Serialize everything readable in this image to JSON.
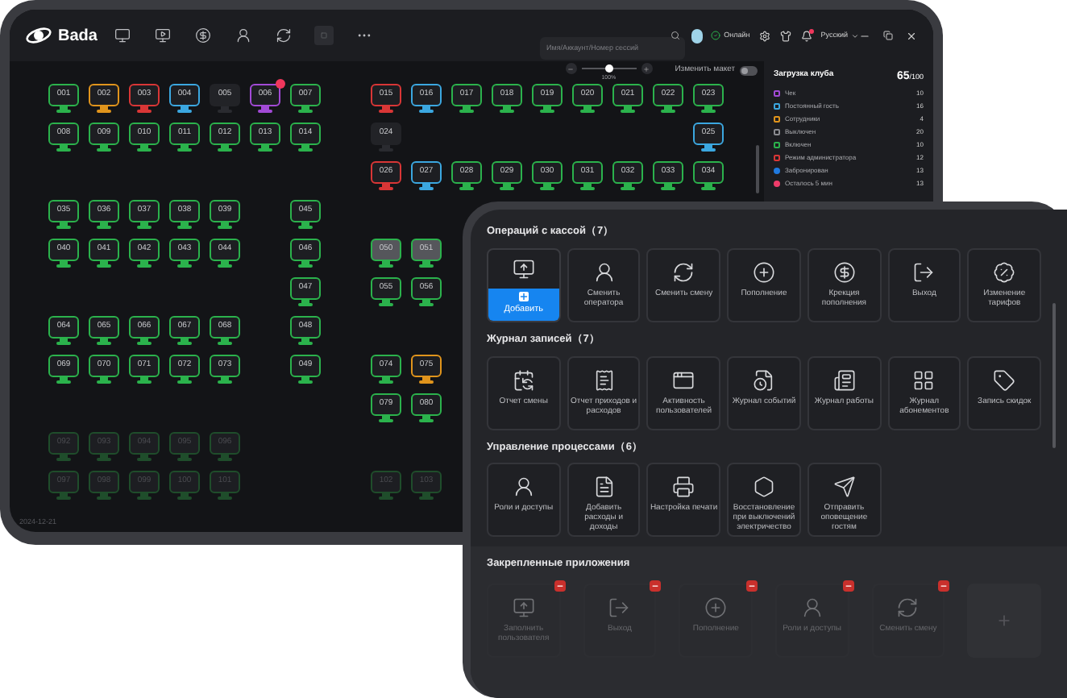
{
  "app": {
    "name": "Bada"
  },
  "search": {
    "placeholder": "Имя/Аккаунт/Номер сессий"
  },
  "status": {
    "label": "Онлайн"
  },
  "language": {
    "label": "Русский"
  },
  "notifications": {
    "unread": true
  },
  "zoom": {
    "level": 0.5,
    "reading": "100%"
  },
  "layout_toggle": {
    "label": "Изменить макет",
    "on": false
  },
  "seat_rows": [
    [
      {
        "label": "001",
        "color": "#2bb24c",
        "kind": "on",
        "alert": false
      },
      {
        "label": "002",
        "color": "#e0941c",
        "kind": "on",
        "alert": false
      },
      {
        "label": "003",
        "color": "#d93636",
        "kind": "on",
        "alert": false
      },
      {
        "label": "004",
        "color": "#3ba7e0",
        "kind": "on",
        "alert": false
      },
      {
        "label": "005",
        "color": "#2a2b30",
        "kind": "off",
        "alert": false
      },
      {
        "label": "006",
        "color": "#a24ad6",
        "kind": "on",
        "alert": true
      },
      {
        "label": "007",
        "color": "#2bb24c",
        "kind": "on",
        "alert": false
      },
      null,
      {
        "label": "015",
        "color": "#d93636",
        "kind": "on",
        "alert": false
      },
      {
        "label": "016",
        "color": "#3ba7e0",
        "kind": "on",
        "alert": false
      },
      {
        "label": "017",
        "color": "#2bb24c",
        "kind": "on",
        "alert": false
      },
      {
        "label": "018",
        "color": "#2bb24c",
        "kind": "on",
        "alert": false
      },
      {
        "label": "019",
        "color": "#2bb24c",
        "kind": "on",
        "alert": false
      },
      {
        "label": "020",
        "color": "#2bb24c",
        "kind": "on",
        "alert": false
      },
      {
        "label": "021",
        "color": "#2bb24c",
        "kind": "on",
        "alert": false
      },
      {
        "label": "022",
        "color": "#2bb24c",
        "kind": "on",
        "alert": false
      },
      {
        "label": "023",
        "color": "#2bb24c",
        "kind": "on",
        "alert": false
      }
    ],
    [
      {
        "label": "008",
        "color": "#2bb24c",
        "kind": "on",
        "alert": false
      },
      {
        "label": "009",
        "color": "#2bb24c",
        "kind": "on",
        "alert": false
      },
      {
        "label": "010",
        "color": "#2bb24c",
        "kind": "on",
        "alert": false
      },
      {
        "label": "011",
        "color": "#2bb24c",
        "kind": "on",
        "alert": false
      },
      {
        "label": "012",
        "color": "#2bb24c",
        "kind": "on",
        "alert": false
      },
      {
        "label": "013",
        "color": "#2bb24c",
        "kind": "on",
        "alert": false
      },
      {
        "label": "014",
        "color": "#2bb24c",
        "kind": "on",
        "alert": false
      },
      null,
      {
        "label": "024",
        "color": "#2a2b30",
        "kind": "off",
        "alert": false
      },
      null,
      null,
      null,
      null,
      null,
      null,
      null,
      {
        "label": "025",
        "color": "#3ba7e0",
        "kind": "on",
        "alert": false
      }
    ],
    [
      null,
      null,
      null,
      null,
      null,
      null,
      null,
      null,
      {
        "label": "026",
        "color": "#d93636",
        "kind": "on",
        "alert": false
      },
      {
        "label": "027",
        "color": "#3ba7e0",
        "kind": "on",
        "alert": false
      },
      {
        "label": "028",
        "color": "#2bb24c",
        "kind": "on",
        "alert": false
      },
      {
        "label": "029",
        "color": "#2bb24c",
        "kind": "on",
        "alert": false
      },
      {
        "label": "030",
        "color": "#2bb24c",
        "kind": "on",
        "alert": false
      },
      {
        "label": "031",
        "color": "#2bb24c",
        "kind": "on",
        "alert": false
      },
      {
        "label": "032",
        "color": "#2bb24c",
        "kind": "on",
        "alert": false
      },
      {
        "label": "033",
        "color": "#2bb24c",
        "kind": "on",
        "alert": false
      },
      {
        "label": "034",
        "color": "#2bb24c",
        "kind": "on",
        "alert": false
      }
    ],
    [
      {
        "label": "035",
        "color": "#2bb24c",
        "kind": "on",
        "alert": false
      },
      {
        "label": "036",
        "color": "#2bb24c",
        "kind": "on",
        "alert": false
      },
      {
        "label": "037",
        "color": "#2bb24c",
        "kind": "on",
        "alert": false
      },
      {
        "label": "038",
        "color": "#2bb24c",
        "kind": "on",
        "alert": false
      },
      {
        "label": "039",
        "color": "#2bb24c",
        "kind": "on",
        "alert": false
      },
      null,
      {
        "label": "045",
        "color": "#2bb24c",
        "kind": "on",
        "alert": false
      }
    ],
    [
      {
        "label": "040",
        "color": "#2bb24c",
        "kind": "on",
        "alert": false
      },
      {
        "label": "041",
        "color": "#2bb24c",
        "kind": "on",
        "alert": false
      },
      {
        "label": "042",
        "color": "#2bb24c",
        "kind": "on",
        "alert": false
      },
      {
        "label": "043",
        "color": "#2bb24c",
        "kind": "on",
        "alert": false
      },
      {
        "label": "044",
        "color": "#2bb24c",
        "kind": "on",
        "alert": false
      },
      null,
      {
        "label": "046",
        "color": "#2bb24c",
        "kind": "on",
        "alert": false
      },
      null,
      {
        "label": "050",
        "color": "#2bb24c",
        "kind": "busy",
        "alert": false
      },
      {
        "label": "051",
        "color": "#2bb24c",
        "kind": "busy",
        "alert": false
      }
    ],
    [
      null,
      null,
      null,
      null,
      null,
      null,
      {
        "label": "047",
        "color": "#2bb24c",
        "kind": "on",
        "alert": false
      },
      null,
      {
        "label": "055",
        "color": "#2bb24c",
        "kind": "on",
        "alert": false
      },
      {
        "label": "056",
        "color": "#2bb24c",
        "kind": "on",
        "alert": false
      }
    ],
    [
      {
        "label": "064",
        "color": "#2bb24c",
        "kind": "on",
        "alert": false
      },
      {
        "label": "065",
        "color": "#2bb24c",
        "kind": "on",
        "alert": false
      },
      {
        "label": "066",
        "color": "#2bb24c",
        "kind": "on",
        "alert": false
      },
      {
        "label": "067",
        "color": "#2bb24c",
        "kind": "on",
        "alert": false
      },
      {
        "label": "068",
        "color": "#2bb24c",
        "kind": "on",
        "alert": false
      },
      null,
      {
        "label": "048",
        "color": "#2bb24c",
        "kind": "on",
        "alert": false
      }
    ],
    [
      {
        "label": "069",
        "color": "#2bb24c",
        "kind": "on",
        "alert": false
      },
      {
        "label": "070",
        "color": "#2bb24c",
        "kind": "on",
        "alert": false
      },
      {
        "label": "071",
        "color": "#2bb24c",
        "kind": "on",
        "alert": false
      },
      {
        "label": "072",
        "color": "#2bb24c",
        "kind": "on",
        "alert": false
      },
      {
        "label": "073",
        "color": "#2bb24c",
        "kind": "on",
        "alert": false
      },
      null,
      {
        "label": "049",
        "color": "#2bb24c",
        "kind": "on",
        "alert": false
      },
      null,
      {
        "label": "074",
        "color": "#2bb24c",
        "kind": "on",
        "alert": false
      },
      {
        "label": "075",
        "color": "#e0941c",
        "kind": "on",
        "alert": false
      }
    ],
    [
      null,
      null,
      null,
      null,
      null,
      null,
      null,
      null,
      {
        "label": "079",
        "color": "#2bb24c",
        "kind": "on",
        "alert": false
      },
      {
        "label": "080",
        "color": "#2bb24c",
        "kind": "on",
        "alert": false
      }
    ],
    [
      {
        "label": "092",
        "color": "#1f4d2b",
        "kind": "faded",
        "alert": false
      },
      {
        "label": "093",
        "color": "#1f4d2b",
        "kind": "faded",
        "alert": false
      },
      {
        "label": "094",
        "color": "#1f4d2b",
        "kind": "faded",
        "alert": false
      },
      {
        "label": "095",
        "color": "#1f4d2b",
        "kind": "faded",
        "alert": false
      },
      {
        "label": "096",
        "color": "#1f4d2b",
        "kind": "faded",
        "alert": false
      }
    ],
    [
      {
        "label": "097",
        "color": "#1f4d2b",
        "kind": "faded",
        "alert": false
      },
      {
        "label": "098",
        "color": "#1f4d2b",
        "kind": "faded",
        "alert": false
      },
      {
        "label": "099",
        "color": "#1f4d2b",
        "kind": "faded",
        "alert": false
      },
      {
        "label": "100",
        "color": "#1f4d2b",
        "kind": "faded",
        "alert": false
      },
      {
        "label": "101",
        "color": "#1f4d2b",
        "kind": "faded",
        "alert": false
      },
      null,
      null,
      null,
      {
        "label": "102",
        "color": "#1f4d2b",
        "kind": "faded",
        "alert": false
      },
      {
        "label": "103",
        "color": "#1f4d2b",
        "kind": "faded",
        "alert": false
      }
    ]
  ],
  "footer": {
    "date": "2024-12-21"
  },
  "club_load": {
    "title": "Загрузка клуба",
    "value": "65",
    "total": "/100",
    "items": [
      {
        "label": "Чек",
        "count": "10",
        "color": "#a24ad6",
        "kind": "square"
      },
      {
        "label": "Постоянный гость",
        "count": "16",
        "color": "#3ba7e0",
        "kind": "square"
      },
      {
        "label": "Сотрудники",
        "count": "4",
        "color": "#e0941c",
        "kind": "square"
      },
      {
        "label": "Выключен",
        "count": "20",
        "color": "#8a8b90",
        "kind": "square"
      },
      {
        "label": "Включен",
        "count": "10",
        "color": "#2bb24c",
        "kind": "square"
      },
      {
        "label": "Режим администратора",
        "count": "12",
        "color": "#d93636",
        "kind": "square"
      },
      {
        "label": "Забронирован",
        "count": "13",
        "color": "#1f7ae0",
        "kind": "dot"
      },
      {
        "label": "Осталось 5 мин",
        "count": "13",
        "color": "#ee3c6a",
        "kind": "dot"
      }
    ]
  },
  "sections": [
    {
      "title": "Операций с кассой（7）",
      "tiles": [
        {
          "label": "Добавить",
          "kind": "monitor-up",
          "selected": true
        },
        {
          "label": "Сменить оператора",
          "kind": "user",
          "selected": false
        },
        {
          "label": "Сменить смену",
          "kind": "cycle",
          "selected": false
        },
        {
          "label": "Пополнение",
          "kind": "coin-plus",
          "selected": false
        },
        {
          "label": "Крекция пополнения",
          "kind": "coin",
          "selected": false
        },
        {
          "label": "Выход",
          "kind": "exit",
          "selected": false
        },
        {
          "label": "Изменение тарифов",
          "kind": "percent",
          "selected": false
        }
      ]
    },
    {
      "title": "Журнал записей（7）",
      "tiles": [
        {
          "label": "Отчет смены",
          "kind": "calendar",
          "selected": false
        },
        {
          "label": "Отчет приходов и расходов",
          "kind": "receipt",
          "selected": false
        },
        {
          "label": "Активность пользователей",
          "kind": "window",
          "selected": false
        },
        {
          "label": "Журнал событий",
          "kind": "file-clock",
          "selected": false
        },
        {
          "label": "Журнал работы",
          "kind": "news",
          "selected": false
        },
        {
          "label": "Журнал абонементов",
          "kind": "grid",
          "selected": false
        },
        {
          "label": "Запись скидок",
          "kind": "tag",
          "selected": false
        }
      ]
    },
    {
      "title": "Управление процессами（6）",
      "tiles": [
        {
          "label": "Роли и доступы",
          "kind": "user",
          "selected": false
        },
        {
          "label": "Добавить расходы и доходы",
          "kind": "file",
          "selected": false
        },
        {
          "label": "Настройка печати",
          "kind": "printer",
          "selected": false
        },
        {
          "label": "Восстановление при выключений электричество",
          "kind": "hexagon",
          "selected": false
        },
        {
          "label": "Отправить оповещение гостям",
          "kind": "send",
          "selected": false
        }
      ]
    }
  ],
  "pinned": {
    "title": "Закрепленные приложения",
    "tiles": [
      {
        "label": "Заполнить пользователя",
        "kind": "monitor-up"
      },
      {
        "label": "Выход",
        "kind": "exit"
      },
      {
        "label": "Пополнение",
        "kind": "coin-plus"
      },
      {
        "label": "Роли и доступы",
        "kind": "user"
      },
      {
        "label": "Сменить смену",
        "kind": "cycle"
      }
    ]
  }
}
